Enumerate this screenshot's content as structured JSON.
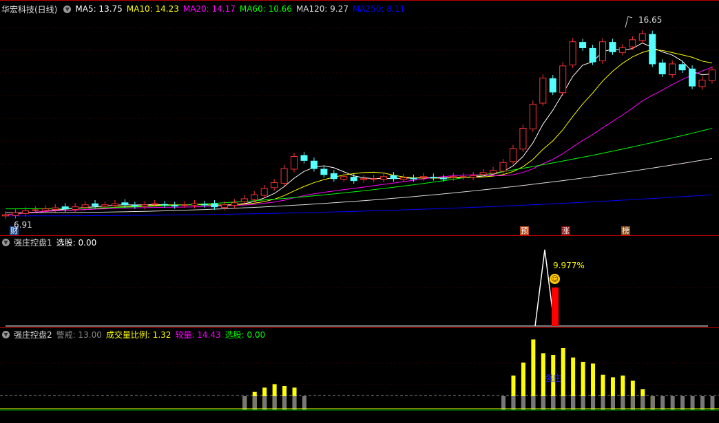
{
  "main": {
    "title": "华宏科技(日线)",
    "ma": [
      {
        "label": "MA5: 13.75",
        "color": "#ffffff"
      },
      {
        "label": "MA10: 14.23",
        "color": "#ffff00"
      },
      {
        "label": "MA20: 14.17",
        "color": "#ff00ff"
      },
      {
        "label": "MA60: 10.66",
        "color": "#00ff00"
      },
      {
        "label": "MA120: 9.27",
        "color": "#dddddd"
      },
      {
        "label": "MA250: 8.11",
        "color": "#0000ff"
      }
    ],
    "high_label": "16.65",
    "low_label": "6.91",
    "tags": {
      "cai": "财",
      "yu": "预",
      "zhang": "涨",
      "bang": "榜"
    },
    "closes": [
      7.0,
      7.1,
      7.2,
      7.25,
      7.3,
      7.35,
      7.3,
      7.4,
      7.5,
      7.45,
      7.5,
      7.55,
      7.5,
      7.45,
      7.5,
      7.55,
      7.5,
      7.45,
      7.5,
      7.55,
      7.5,
      7.4,
      7.5,
      7.6,
      7.8,
      8.0,
      8.3,
      8.6,
      9.3,
      9.9,
      9.7,
      9.3,
      9.0,
      8.8,
      8.9,
      8.7,
      8.8,
      8.8,
      8.9,
      8.8,
      8.85,
      8.8,
      8.9,
      8.85,
      8.8,
      8.9,
      8.9,
      8.95,
      9.1,
      9.2,
      9.6,
      10.3,
      11.3,
      12.5,
      13.8,
      13.1,
      14.4,
      15.6,
      15.3,
      14.6,
      15.6,
      15.1,
      15.3,
      15.7,
      16.0,
      14.5,
      14.0,
      14.5,
      14.2,
      13.4,
      13.7,
      14.2
    ]
  },
  "ind1": {
    "title": "强庄控盘1",
    "xg": "选股: 0.00",
    "pct": "9.977%"
  },
  "ind2": {
    "title": "强庄控盘2",
    "warn": "警戒: 13.00",
    "ratio": "成交量比例: 1.32",
    "jl": "较量: 14.43",
    "xg": "选股: 0.00",
    "mark": "强庄",
    "volumes": [
      1,
      1,
      1,
      1,
      1,
      1,
      1,
      1,
      1,
      1,
      1,
      1,
      1,
      1,
      1,
      1,
      1,
      1,
      1,
      1,
      1,
      1,
      1,
      1,
      1.6,
      2.1,
      2.6,
      3.0,
      2.8,
      2.6,
      1.6,
      1,
      1,
      1,
      1,
      1,
      1,
      1,
      1,
      1,
      1,
      1,
      1,
      1,
      1,
      1,
      1,
      1,
      1,
      1,
      1.6,
      4.0,
      5.5,
      8.2,
      6.6,
      6.4,
      7.2,
      6.1,
      5.6,
      5.4,
      4.1,
      3.8,
      4.0,
      3.4,
      2.4,
      1.6,
      1.0,
      0.8,
      0.8,
      1.1,
      1.2,
      1.3
    ]
  }
}
